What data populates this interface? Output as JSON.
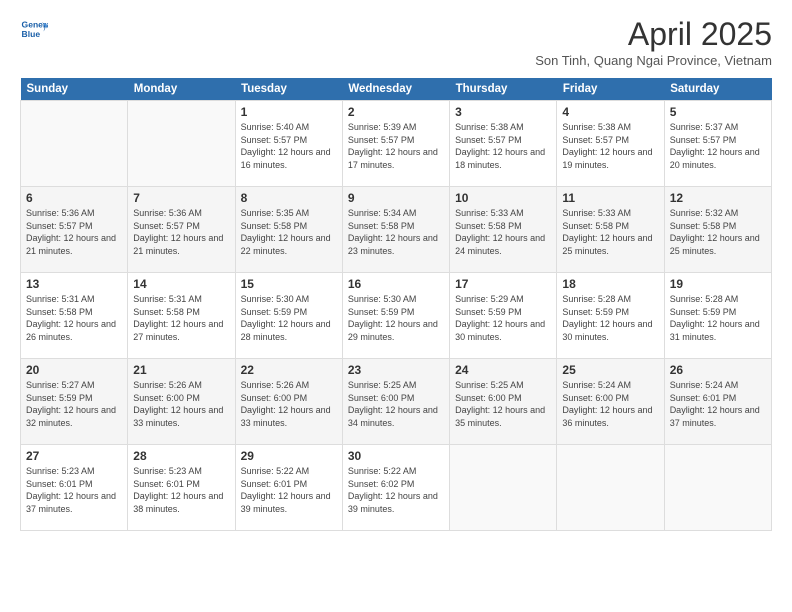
{
  "header": {
    "logo_line1": "General",
    "logo_line2": "Blue",
    "title": "April 2025",
    "subtitle": "Son Tinh, Quang Ngai Province, Vietnam"
  },
  "days_of_week": [
    "Sunday",
    "Monday",
    "Tuesday",
    "Wednesday",
    "Thursday",
    "Friday",
    "Saturday"
  ],
  "weeks": [
    [
      {
        "day": "",
        "sunrise": "",
        "sunset": "",
        "daylight": ""
      },
      {
        "day": "",
        "sunrise": "",
        "sunset": "",
        "daylight": ""
      },
      {
        "day": "1",
        "sunrise": "Sunrise: 5:40 AM",
        "sunset": "Sunset: 5:57 PM",
        "daylight": "Daylight: 12 hours and 16 minutes."
      },
      {
        "day": "2",
        "sunrise": "Sunrise: 5:39 AM",
        "sunset": "Sunset: 5:57 PM",
        "daylight": "Daylight: 12 hours and 17 minutes."
      },
      {
        "day": "3",
        "sunrise": "Sunrise: 5:38 AM",
        "sunset": "Sunset: 5:57 PM",
        "daylight": "Daylight: 12 hours and 18 minutes."
      },
      {
        "day": "4",
        "sunrise": "Sunrise: 5:38 AM",
        "sunset": "Sunset: 5:57 PM",
        "daylight": "Daylight: 12 hours and 19 minutes."
      },
      {
        "day": "5",
        "sunrise": "Sunrise: 5:37 AM",
        "sunset": "Sunset: 5:57 PM",
        "daylight": "Daylight: 12 hours and 20 minutes."
      }
    ],
    [
      {
        "day": "6",
        "sunrise": "Sunrise: 5:36 AM",
        "sunset": "Sunset: 5:57 PM",
        "daylight": "Daylight: 12 hours and 21 minutes."
      },
      {
        "day": "7",
        "sunrise": "Sunrise: 5:36 AM",
        "sunset": "Sunset: 5:57 PM",
        "daylight": "Daylight: 12 hours and 21 minutes."
      },
      {
        "day": "8",
        "sunrise": "Sunrise: 5:35 AM",
        "sunset": "Sunset: 5:58 PM",
        "daylight": "Daylight: 12 hours and 22 minutes."
      },
      {
        "day": "9",
        "sunrise": "Sunrise: 5:34 AM",
        "sunset": "Sunset: 5:58 PM",
        "daylight": "Daylight: 12 hours and 23 minutes."
      },
      {
        "day": "10",
        "sunrise": "Sunrise: 5:33 AM",
        "sunset": "Sunset: 5:58 PM",
        "daylight": "Daylight: 12 hours and 24 minutes."
      },
      {
        "day": "11",
        "sunrise": "Sunrise: 5:33 AM",
        "sunset": "Sunset: 5:58 PM",
        "daylight": "Daylight: 12 hours and 25 minutes."
      },
      {
        "day": "12",
        "sunrise": "Sunrise: 5:32 AM",
        "sunset": "Sunset: 5:58 PM",
        "daylight": "Daylight: 12 hours and 25 minutes."
      }
    ],
    [
      {
        "day": "13",
        "sunrise": "Sunrise: 5:31 AM",
        "sunset": "Sunset: 5:58 PM",
        "daylight": "Daylight: 12 hours and 26 minutes."
      },
      {
        "day": "14",
        "sunrise": "Sunrise: 5:31 AM",
        "sunset": "Sunset: 5:58 PM",
        "daylight": "Daylight: 12 hours and 27 minutes."
      },
      {
        "day": "15",
        "sunrise": "Sunrise: 5:30 AM",
        "sunset": "Sunset: 5:59 PM",
        "daylight": "Daylight: 12 hours and 28 minutes."
      },
      {
        "day": "16",
        "sunrise": "Sunrise: 5:30 AM",
        "sunset": "Sunset: 5:59 PM",
        "daylight": "Daylight: 12 hours and 29 minutes."
      },
      {
        "day": "17",
        "sunrise": "Sunrise: 5:29 AM",
        "sunset": "Sunset: 5:59 PM",
        "daylight": "Daylight: 12 hours and 30 minutes."
      },
      {
        "day": "18",
        "sunrise": "Sunrise: 5:28 AM",
        "sunset": "Sunset: 5:59 PM",
        "daylight": "Daylight: 12 hours and 30 minutes."
      },
      {
        "day": "19",
        "sunrise": "Sunrise: 5:28 AM",
        "sunset": "Sunset: 5:59 PM",
        "daylight": "Daylight: 12 hours and 31 minutes."
      }
    ],
    [
      {
        "day": "20",
        "sunrise": "Sunrise: 5:27 AM",
        "sunset": "Sunset: 5:59 PM",
        "daylight": "Daylight: 12 hours and 32 minutes."
      },
      {
        "day": "21",
        "sunrise": "Sunrise: 5:26 AM",
        "sunset": "Sunset: 6:00 PM",
        "daylight": "Daylight: 12 hours and 33 minutes."
      },
      {
        "day": "22",
        "sunrise": "Sunrise: 5:26 AM",
        "sunset": "Sunset: 6:00 PM",
        "daylight": "Daylight: 12 hours and 33 minutes."
      },
      {
        "day": "23",
        "sunrise": "Sunrise: 5:25 AM",
        "sunset": "Sunset: 6:00 PM",
        "daylight": "Daylight: 12 hours and 34 minutes."
      },
      {
        "day": "24",
        "sunrise": "Sunrise: 5:25 AM",
        "sunset": "Sunset: 6:00 PM",
        "daylight": "Daylight: 12 hours and 35 minutes."
      },
      {
        "day": "25",
        "sunrise": "Sunrise: 5:24 AM",
        "sunset": "Sunset: 6:00 PM",
        "daylight": "Daylight: 12 hours and 36 minutes."
      },
      {
        "day": "26",
        "sunrise": "Sunrise: 5:24 AM",
        "sunset": "Sunset: 6:01 PM",
        "daylight": "Daylight: 12 hours and 37 minutes."
      }
    ],
    [
      {
        "day": "27",
        "sunrise": "Sunrise: 5:23 AM",
        "sunset": "Sunset: 6:01 PM",
        "daylight": "Daylight: 12 hours and 37 minutes."
      },
      {
        "day": "28",
        "sunrise": "Sunrise: 5:23 AM",
        "sunset": "Sunset: 6:01 PM",
        "daylight": "Daylight: 12 hours and 38 minutes."
      },
      {
        "day": "29",
        "sunrise": "Sunrise: 5:22 AM",
        "sunset": "Sunset: 6:01 PM",
        "daylight": "Daylight: 12 hours and 39 minutes."
      },
      {
        "day": "30",
        "sunrise": "Sunrise: 5:22 AM",
        "sunset": "Sunset: 6:02 PM",
        "daylight": "Daylight: 12 hours and 39 minutes."
      },
      {
        "day": "",
        "sunrise": "",
        "sunset": "",
        "daylight": ""
      },
      {
        "day": "",
        "sunrise": "",
        "sunset": "",
        "daylight": ""
      },
      {
        "day": "",
        "sunrise": "",
        "sunset": "",
        "daylight": ""
      }
    ]
  ]
}
